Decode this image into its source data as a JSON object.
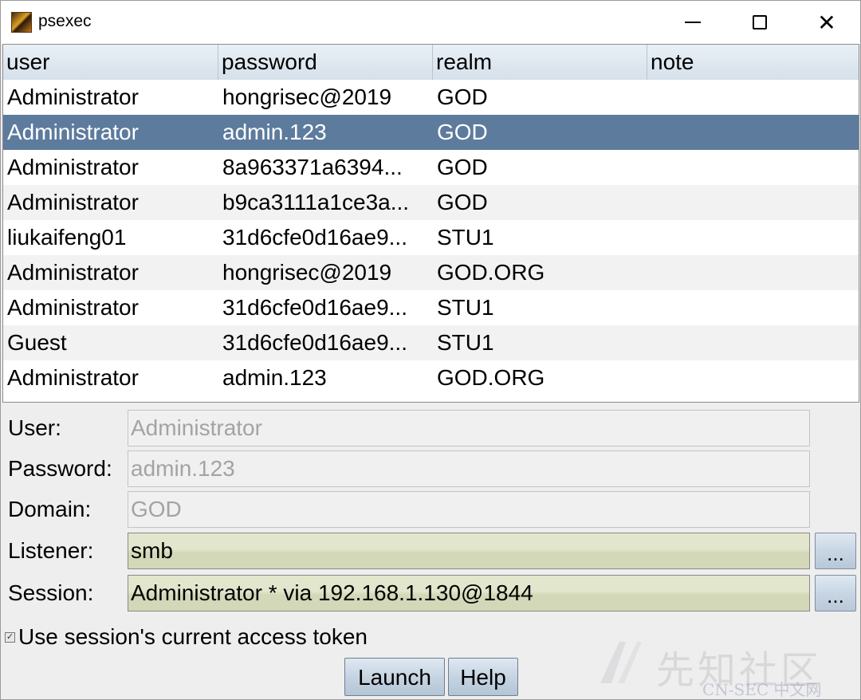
{
  "window": {
    "title": "psexec",
    "min_icon": "minimize-icon",
    "max_icon": "maximize-icon",
    "close_icon": "close-icon",
    "close_glyph": "✕"
  },
  "table": {
    "columns": [
      "user",
      "password",
      "realm",
      "note"
    ],
    "selected_row": 1,
    "rows": [
      {
        "user": "Administrator",
        "password": "hongrisec@2019",
        "realm": "GOD",
        "note": ""
      },
      {
        "user": "Administrator",
        "password": "admin.123",
        "realm": "GOD",
        "note": ""
      },
      {
        "user": "Administrator",
        "password": "8a963371a6394...",
        "realm": "GOD",
        "note": ""
      },
      {
        "user": "Administrator",
        "password": "b9ca3111a1ce3a...",
        "realm": "GOD",
        "note": ""
      },
      {
        "user": "liukaifeng01",
        "password": "31d6cfe0d16ae9...",
        "realm": "STU1",
        "note": ""
      },
      {
        "user": "Administrator",
        "password": "hongrisec@2019",
        "realm": "GOD.ORG",
        "note": ""
      },
      {
        "user": "Administrator",
        "password": "31d6cfe0d16ae9...",
        "realm": "STU1",
        "note": ""
      },
      {
        "user": "Guest",
        "password": "31d6cfe0d16ae9...",
        "realm": "STU1",
        "note": ""
      },
      {
        "user": "Administrator",
        "password": "admin.123",
        "realm": "GOD.ORG",
        "note": ""
      }
    ]
  },
  "form": {
    "user_label": "User:",
    "user_value": "Administrator",
    "password_label": "Password:",
    "password_value": "admin.123",
    "domain_label": "Domain:",
    "domain_value": "GOD",
    "listener_label": "Listener:",
    "listener_value": "smb",
    "session_label": "Session:",
    "session_value": "Administrator * via  192.168.1.130@1844",
    "browse_label": "...",
    "token_checkbox_label": "Use session's current access token",
    "token_checked": true,
    "check_glyph": "✓"
  },
  "buttons": {
    "launch": "Launch",
    "help": "Help"
  },
  "watermark": {
    "text": "先知社区",
    "sub": "CN-SEC 中文网"
  },
  "colors": {
    "selected_row": "#5d7b9d",
    "header": "#dfe7f0",
    "active_field": "#dde1c4"
  }
}
